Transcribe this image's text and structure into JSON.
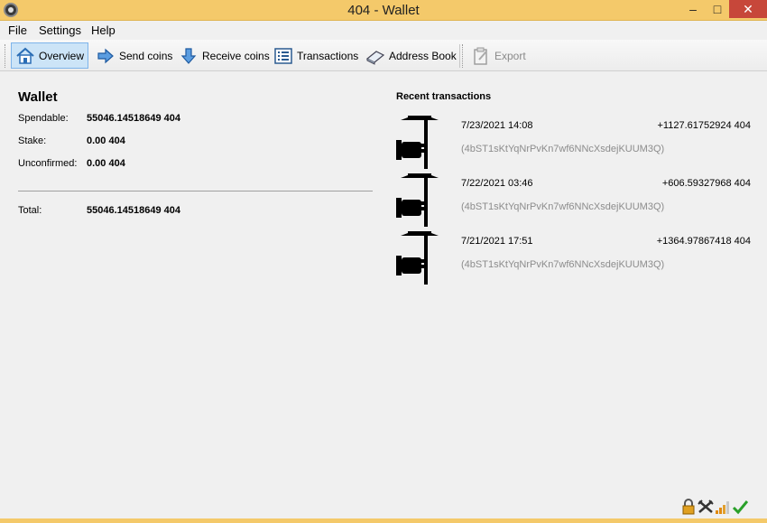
{
  "window": {
    "title": "404 - Wallet",
    "controls": {
      "minimize": "–",
      "maximize": "□",
      "close": "✕"
    }
  },
  "menu": [
    "File",
    "Settings",
    "Help"
  ],
  "toolbar": {
    "overview": "Overview",
    "send": "Send coins",
    "receive": "Receive coins",
    "transactions": "Transactions",
    "address_book": "Address Book",
    "export": "Export"
  },
  "wallet": {
    "title": "Wallet",
    "spendable_label": "Spendable:",
    "spendable_value": "55046.14518649 404",
    "stake_label": "Stake:",
    "stake_value": "0.00 404",
    "unconfirmed_label": "Unconfirmed:",
    "unconfirmed_value": "0.00 404",
    "total_label": "Total:",
    "total_value": "55046.14518649 404"
  },
  "recent": {
    "title": "Recent transactions",
    "items": [
      {
        "date": "7/23/2021 14:08",
        "amount": "+1127.61752924 404",
        "address": "(4bST1sKtYqNrPvKn7wf6NNcXsdejKUUM3Q)"
      },
      {
        "date": "7/22/2021 03:46",
        "amount": "+606.59327968 404",
        "address": "(4bST1sKtYqNrPvKn7wf6NNcXsdejKUUM3Q)"
      },
      {
        "date": "7/21/2021 17:51",
        "amount": "+1364.97867418 404",
        "address": "(4bST1sKtYqNrPvKn7wf6NNcXsdejKUUM3Q)"
      }
    ]
  },
  "status_icons": [
    "lock-icon",
    "mining-icon",
    "signal-icon",
    "synced-check-icon"
  ],
  "colors": {
    "titlebar": "#f4c96a",
    "close": "#c7473a",
    "active_tab": "#cce4f7"
  }
}
